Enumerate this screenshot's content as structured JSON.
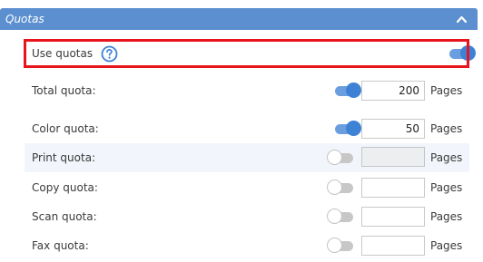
{
  "section": {
    "title": "Quotas",
    "collapse_icon": "chevron-up-icon",
    "header_color": "#5b8fcf"
  },
  "use_quotas": {
    "label": "Use quotas",
    "help_icon": "question-circle-icon",
    "enabled": true,
    "highlight_color": "#e8141c"
  },
  "quotas": [
    {
      "label": "Total quota:",
      "enabled": true,
      "value": "200",
      "unit": "Pages"
    },
    {
      "label": "Color quota:",
      "enabled": true,
      "value": "50",
      "unit": "Pages"
    },
    {
      "label": "Print quota:",
      "enabled": false,
      "value": "",
      "unit": "Pages"
    },
    {
      "label": "Copy quota:",
      "enabled": false,
      "value": "",
      "unit": "Pages"
    },
    {
      "label": "Scan quota:",
      "enabled": false,
      "value": "",
      "unit": "Pages"
    },
    {
      "label": "Fax quota:",
      "enabled": false,
      "value": "",
      "unit": "Pages"
    }
  ],
  "colors": {
    "toggle_on": "#3e82d6",
    "toggle_off": "#c7c7c7",
    "row_alt": "#f2f5fb"
  }
}
